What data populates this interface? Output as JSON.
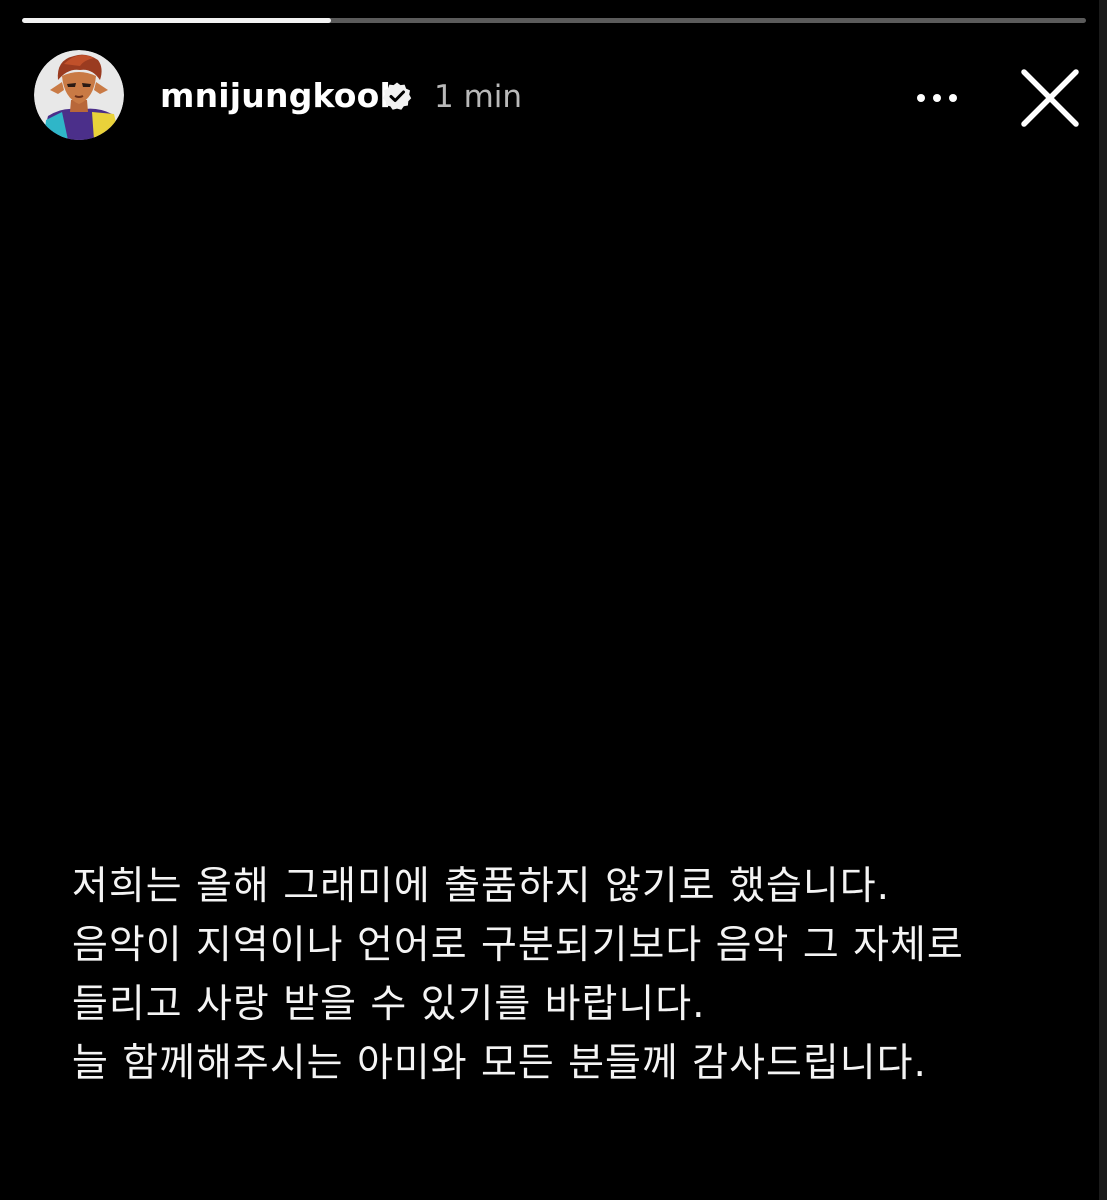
{
  "story": {
    "progress": 0.29,
    "header": {
      "username": "mnijungkook",
      "verified": true,
      "time_ago": "1 min",
      "more_icon": "more-horizontal-icon",
      "close_icon": "close-icon"
    },
    "message_lines": [
      "저희는 올해 그래미에 출품하지 않기로 했습니다.",
      "음악이 지역이나 언어로 구분되기보다 음악 그 자체로",
      "들리고 사랑 받을 수 있기를 바랍니다.",
      "늘 함께해주시는 아미와 모든 분들께 감사드립니다."
    ]
  },
  "colors": {
    "background": "#000000",
    "text": "#f4f4f4",
    "secondary_text": "#b9b9b9",
    "progress_fill": "#f2f2f2",
    "progress_track": "#5b5b5b"
  }
}
